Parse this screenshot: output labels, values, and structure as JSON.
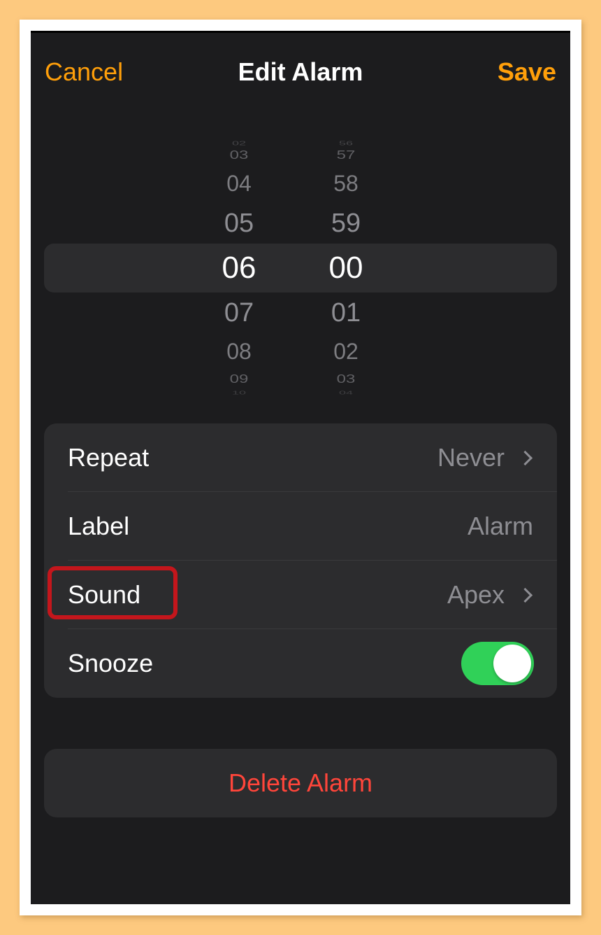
{
  "nav": {
    "cancel_label": "Cancel",
    "title": "Edit Alarm",
    "save_label": "Save"
  },
  "picker": {
    "hours": [
      "02",
      "03",
      "04",
      "05",
      "06",
      "07",
      "08",
      "09",
      "10"
    ],
    "minutes": [
      "56",
      "57",
      "58",
      "59",
      "00",
      "01",
      "02",
      "03",
      "04"
    ],
    "selected_hour": "06",
    "selected_minute": "00"
  },
  "settings": {
    "repeat": {
      "label": "Repeat",
      "value": "Never"
    },
    "label": {
      "label": "Label",
      "value": "Alarm"
    },
    "sound": {
      "label": "Sound",
      "value": "Apex"
    },
    "snooze": {
      "label": "Snooze",
      "on": true
    }
  },
  "delete_label": "Delete Alarm",
  "colors": {
    "accent": "#ff9f0a",
    "toggle_on": "#30d158",
    "destructive": "#ff453a",
    "background": "#1c1c1e",
    "cell": "#2c2c2e",
    "highlight_box": "#c4161c"
  },
  "icons": {
    "row_chevron": "chevron-right-icon"
  }
}
